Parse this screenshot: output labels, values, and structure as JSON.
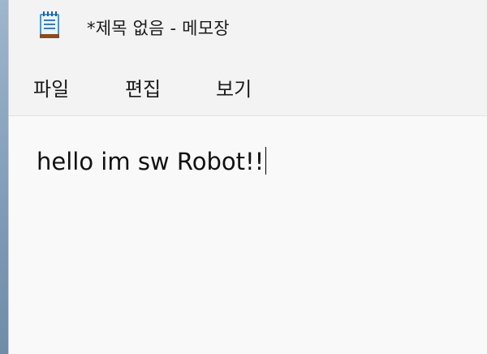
{
  "window": {
    "title": "*제목 없음 - 메모장",
    "app_icon": "notepad-icon"
  },
  "menu": {
    "file_label": "파일",
    "edit_label": "편집",
    "view_label": "보기"
  },
  "editor": {
    "content": "hello im sw Robot!!"
  },
  "colors": {
    "window_bg": "#f9f9f9",
    "chrome_bg": "#f3f3f3",
    "desktop_bg": "#8fa8c0",
    "icon_accent": "#2f8fd8",
    "icon_binding": "#8a4b1f"
  }
}
